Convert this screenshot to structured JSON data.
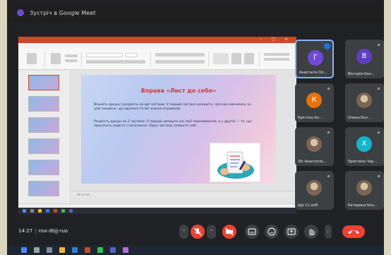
{
  "window": {
    "title": "Зустріч в Google Meet"
  },
  "presentation": {
    "doc_title": "",
    "slide_title": "Вправа «Лист до себе»",
    "paragraphs": [
      "Візьміть аркуш і розділіть на дві частини. У першій частині напишіть, чого ви навчились за цей тиждень, що вдалося та які знання отримали.",
      "Розділіть аркуш на 2 частини. У першій напишіть всі свої переживання, а у другій — те, що приносить радість і натхнення. Одну частину залиште собі."
    ],
    "notes_placeholder": "Нотатки",
    "thumb_count": 6
  },
  "participants": [
    {
      "name": "Анастасія Ол...",
      "initial": "Г",
      "color": "#6f4ad8",
      "speaking": true,
      "mic": "on"
    },
    {
      "name": "Вікторія Бон...",
      "initial": "В",
      "color": "#5e3ec0",
      "speaking": false,
      "mic": "off"
    },
    {
      "name": "Крістіна Ал...",
      "initial": "К",
      "color": "#e8710a",
      "speaking": false,
      "mic": "off"
    },
    {
      "name": "Олена Бон...",
      "initial": "",
      "color": "photo",
      "speaking": false,
      "mic": "off"
    },
    {
      "name": "Ліс Анастасія...",
      "initial": "",
      "color": "photo",
      "speaking": false,
      "mic": "off"
    },
    {
      "name": "Христина Чор...",
      "initial": "Х",
      "color": "#12b5cb",
      "speaking": false,
      "mic": "off"
    },
    {
      "name": "Ще 11 осіб",
      "initial": "",
      "color": "photo",
      "speaking": false,
      "mic": "off"
    },
    {
      "name": "Катерина Бон...",
      "initial": "",
      "color": "photo",
      "speaking": false,
      "mic": "off"
    }
  ],
  "meeting": {
    "time": "14:27",
    "code": "nsx-dbjj-ruo"
  },
  "controls": {
    "mic_icon": "mic-off-icon",
    "camera_icon": "camera-off-icon",
    "captions_icon": "captions-icon",
    "emoji_icon": "emoji-icon",
    "present_icon": "present-icon",
    "raise_hand_icon": "hand-icon",
    "more_icon": "more-icon",
    "hangup_icon": "phone-hangup-icon"
  },
  "colors": {
    "accent": "#8ab4f8",
    "danger": "#ea4335",
    "background": "#202124",
    "ppt_brand": "#c84b28"
  }
}
